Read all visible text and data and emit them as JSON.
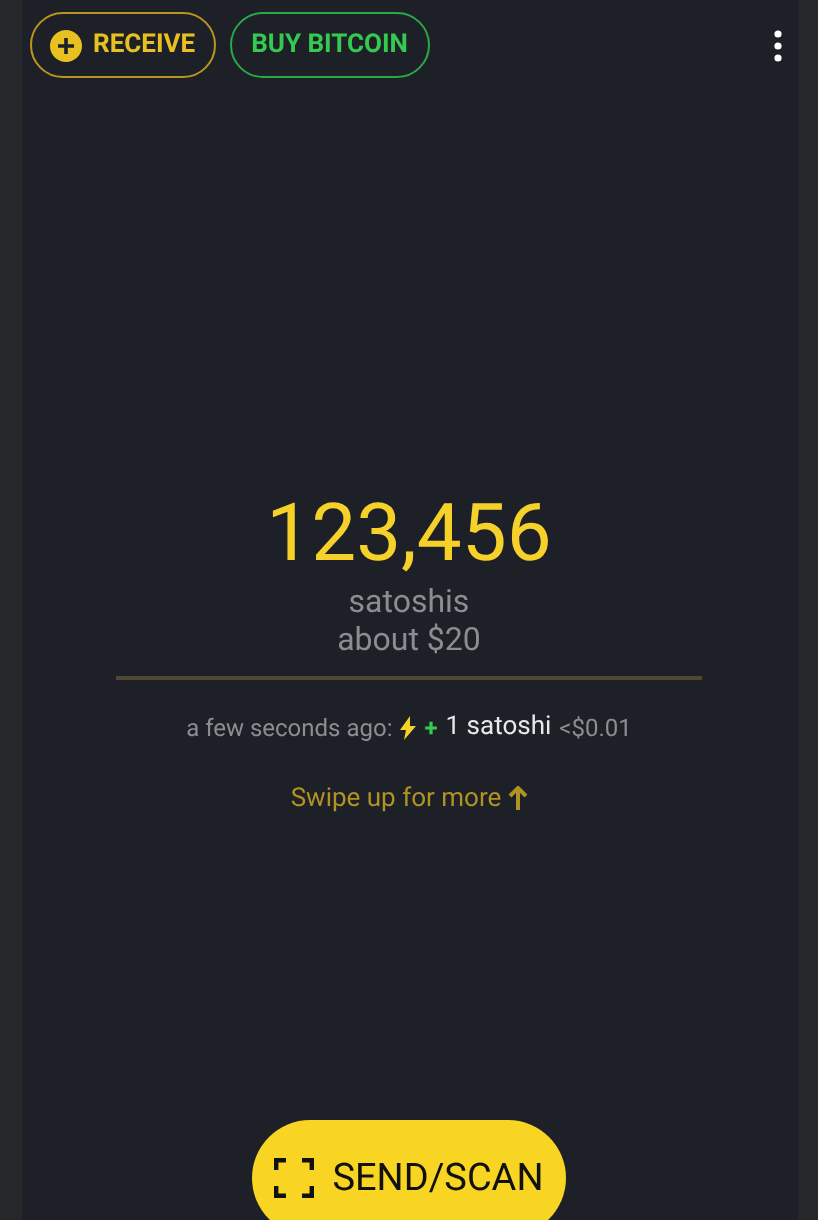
{
  "top_bar": {
    "receive": "RECEIVE",
    "buy": "BUY BITCOIN"
  },
  "balance": {
    "amount": "123,456",
    "unit": "satoshis",
    "fiat": "about $20"
  },
  "last_transaction": {
    "time": "a few seconds ago:",
    "sign": "+",
    "amount": "1 satoshi",
    "fiat": "<$0.01"
  },
  "swipe_hint": "Swipe up for more",
  "send_button": "SEND/SCAN"
}
